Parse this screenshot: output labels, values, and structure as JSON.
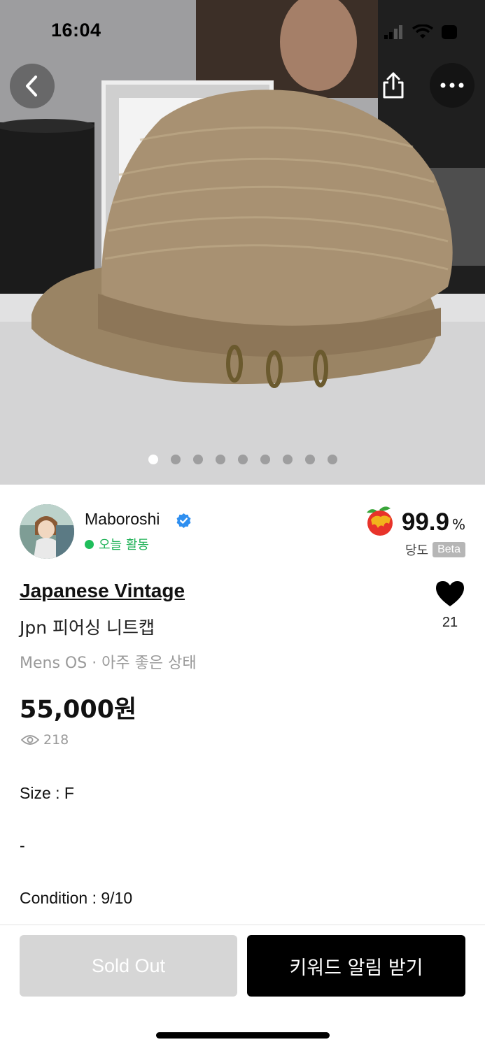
{
  "status_bar": {
    "time": "16:04"
  },
  "nav": {
    "back_icon": "chevron-left-icon",
    "share_icon": "share-icon",
    "more_icon": "more-horizontal-icon"
  },
  "gallery": {
    "total_images": 9,
    "active_index": 0
  },
  "seller": {
    "name": "Maboroshi",
    "verified": true,
    "activity": "오늘 활동",
    "rating_value": "99.9",
    "rating_unit": "%",
    "rating_label": "당도",
    "rating_badge": "Beta"
  },
  "product": {
    "brand": "Japanese Vintage",
    "title": "Jpn 피어싱 니트캡",
    "meta": "Mens OS · 아주 좋은 상태",
    "price": "55,000원",
    "views": "218",
    "likes": "21"
  },
  "description": {
    "line1": "Size : F",
    "line2": "-",
    "line3": "Condition : 9/10"
  },
  "actions": {
    "sold_out_label": "Sold Out",
    "keyword_alert_label": "키워드 알림 받기"
  },
  "colors": {
    "accent_green": "#1fbe5b",
    "verified_blue": "#2f8ff0",
    "primary_button": "#000000",
    "disabled_button": "#d6d6d6"
  }
}
